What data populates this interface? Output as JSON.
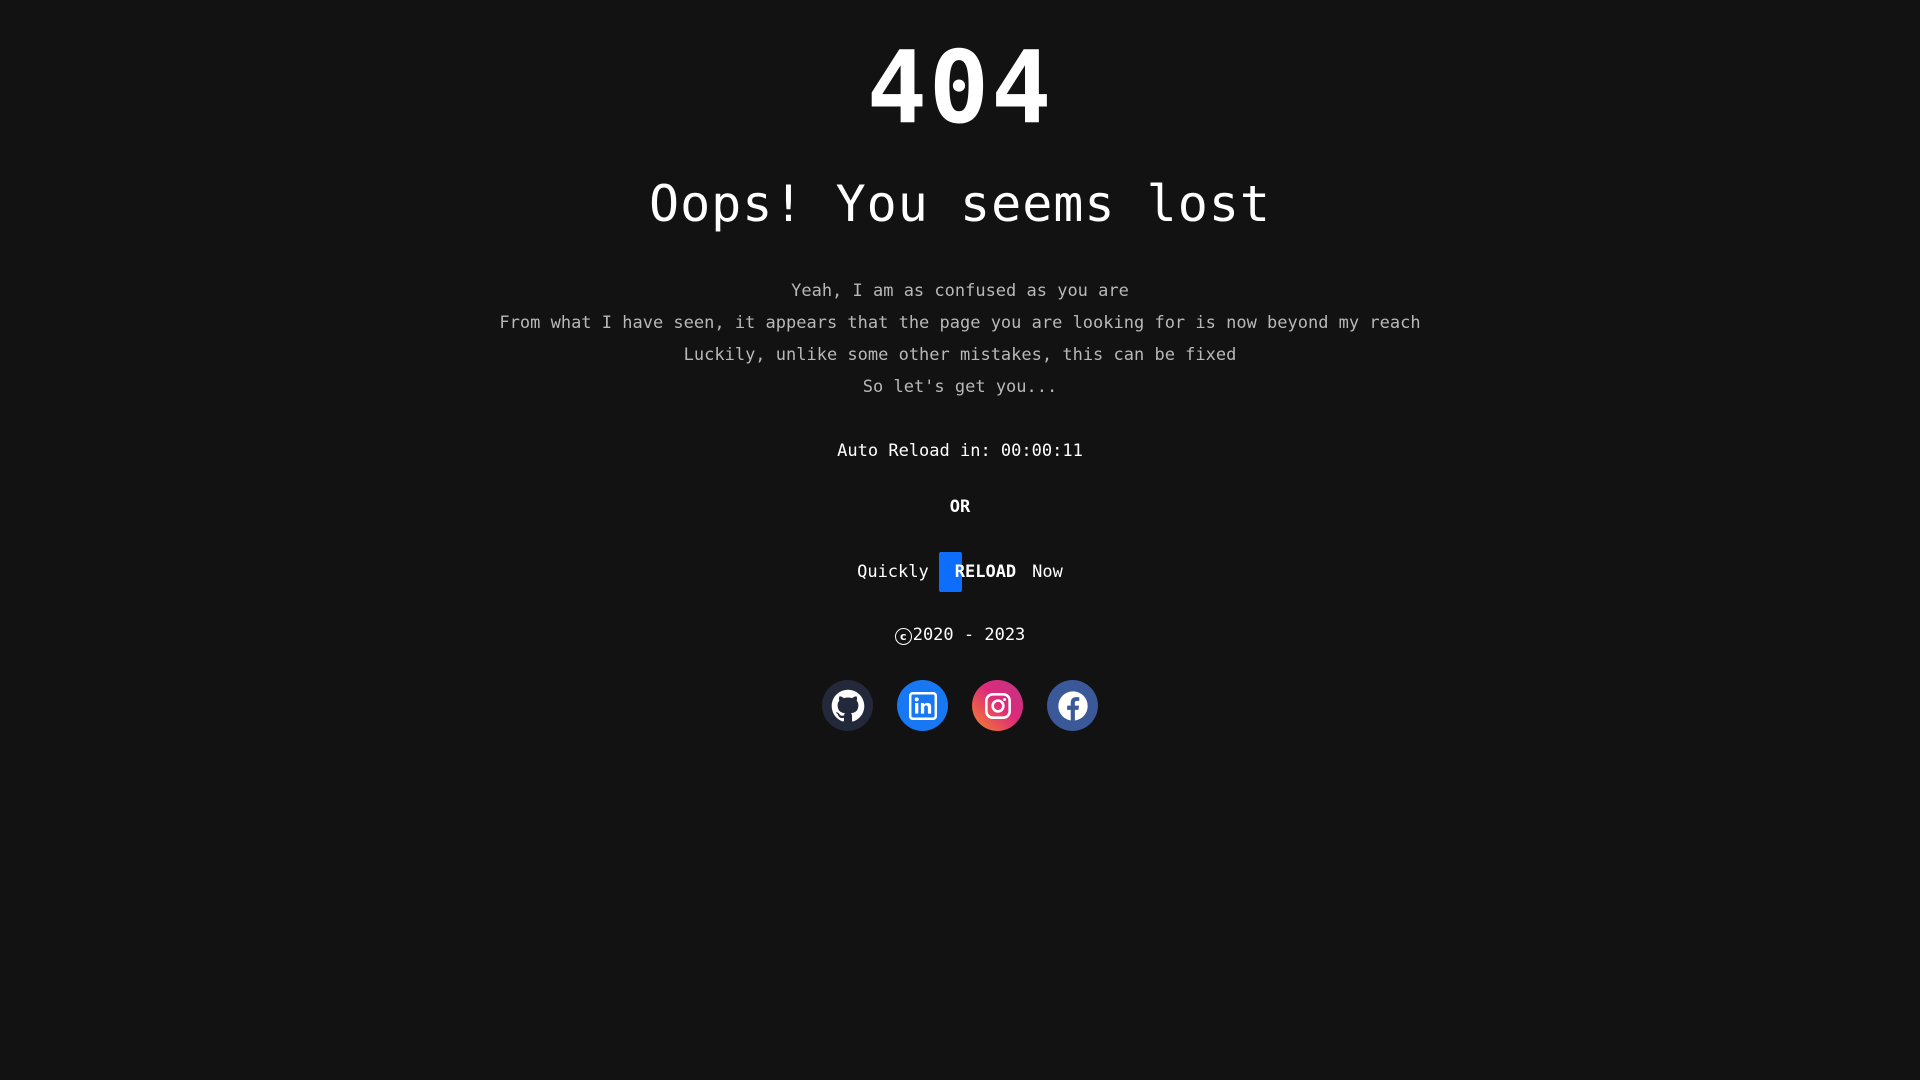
{
  "error": {
    "code": "404",
    "heading": "Oops! You seems lost"
  },
  "messages": [
    "Yeah, I am as confused as you are",
    "From what I have seen, it appears that the page you are looking for is now beyond my reach",
    "Luckily, unlike some other mistakes, this can be fixed",
    "So let's get you..."
  ],
  "auto_reload": {
    "label": "Auto Reload in: 00:00:11"
  },
  "or_label": "OR",
  "reload": {
    "prefix": "Quickly",
    "button_label": "RELOAD",
    "suffix": "Now"
  },
  "copyright": {
    "symbol": "c",
    "years": "2020 - 2023"
  },
  "socials": [
    {
      "icon": "github-icon",
      "color": "#24283b"
    },
    {
      "icon": "linkedin-icon",
      "color": "#1877f2"
    },
    {
      "icon": "instagram-icon",
      "color": "#e1306c"
    },
    {
      "icon": "facebook-icon",
      "color": "#3b5998"
    }
  ],
  "colors": {
    "background": "#121212",
    "accent": "#0d6efd",
    "muted_text": "#b8b8b8"
  }
}
